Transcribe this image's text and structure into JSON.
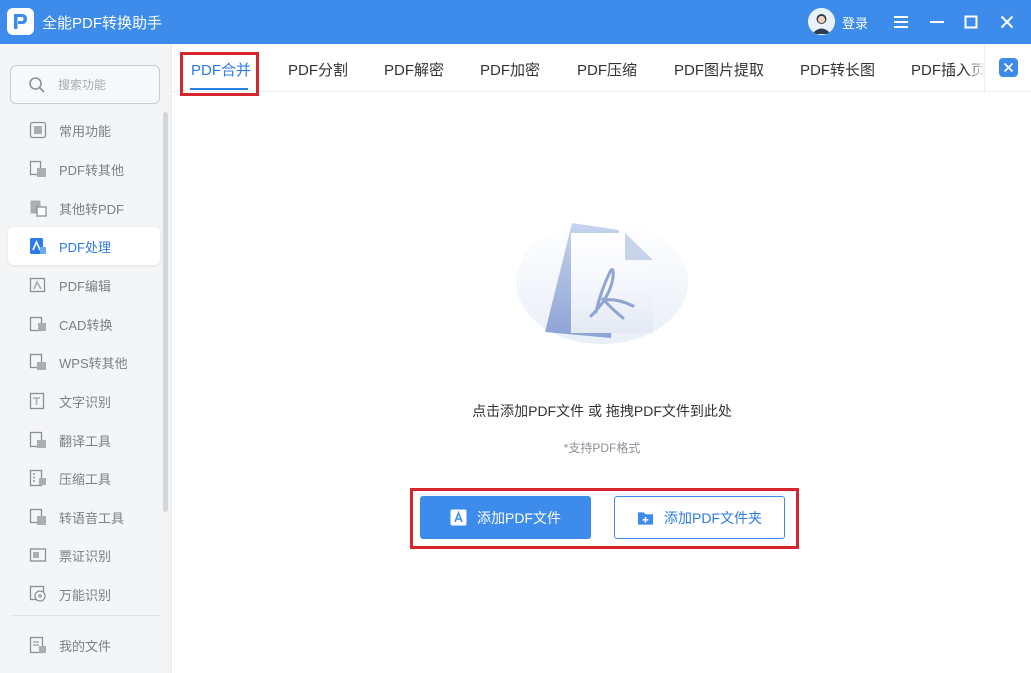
{
  "window": {
    "title": "全能PDF转换助手",
    "login_label": "登录"
  },
  "colors": {
    "brand": "#3d8bea",
    "accent": "#2d7be5",
    "highlight": "#d6262b"
  },
  "sidebar": {
    "search_placeholder": "搜索功能",
    "active_item": "PDF处理",
    "items": [
      {
        "label": "常用功能",
        "icon": "common-functions-icon"
      },
      {
        "label": "PDF转其他",
        "icon": "pdf-to-other-icon"
      },
      {
        "label": "其他转PDF",
        "icon": "other-to-pdf-icon"
      },
      {
        "label": "PDF处理",
        "icon": "pdf-process-icon"
      },
      {
        "label": "PDF编辑",
        "icon": "pdf-edit-icon"
      },
      {
        "label": "CAD转换",
        "icon": "cad-convert-icon"
      },
      {
        "label": "WPS转其他",
        "icon": "wps-convert-icon"
      },
      {
        "label": "文字识别",
        "icon": "text-recognition-icon"
      },
      {
        "label": "翻译工具",
        "icon": "translate-icon"
      },
      {
        "label": "压缩工具",
        "icon": "compress-icon"
      },
      {
        "label": "转语音工具",
        "icon": "text-to-speech-icon"
      },
      {
        "label": "票证识别",
        "icon": "ticket-recognition-icon"
      },
      {
        "label": "万能识别",
        "icon": "universal-recognition-icon"
      }
    ],
    "footer_item": {
      "label": "我的文件",
      "icon": "my-files-icon"
    }
  },
  "tabs": {
    "active": "PDF合并",
    "items": [
      "PDF合并",
      "PDF分割",
      "PDF解密",
      "PDF加密",
      "PDF压缩",
      "PDF图片提取",
      "PDF转长图",
      "PDF插入页"
    ]
  },
  "main": {
    "drop_hint": "点击添加PDF文件 或 拖拽PDF文件到此处",
    "support_note": "*支持PDF格式",
    "add_file_button": "添加PDF文件",
    "add_folder_button": "添加PDF文件夹"
  }
}
